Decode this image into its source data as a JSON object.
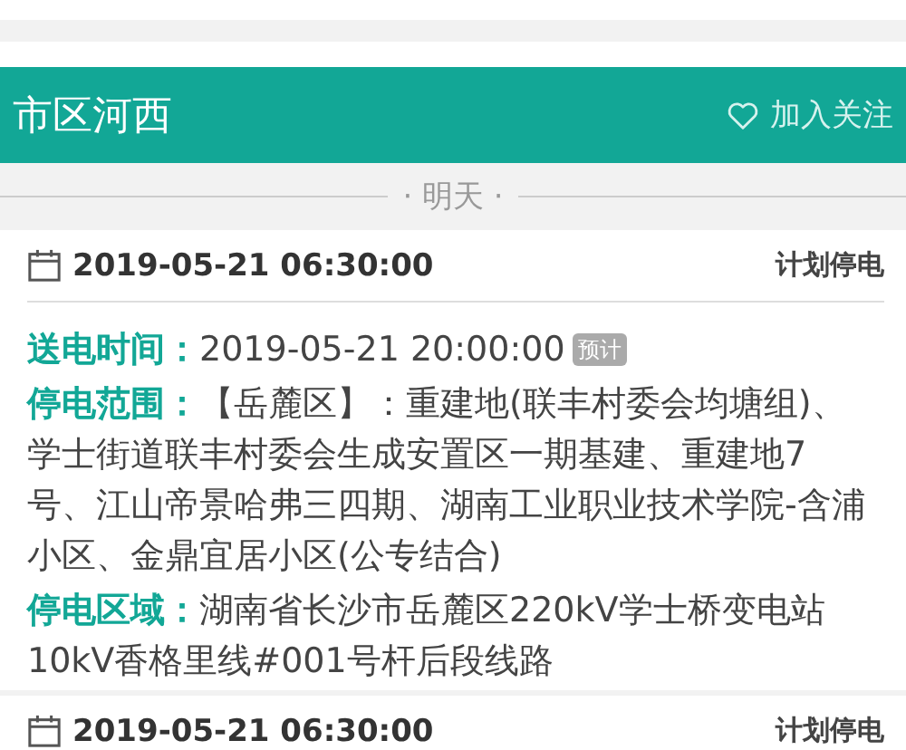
{
  "region": {
    "title": "市区河西",
    "follow_label": "加入关注"
  },
  "day_label": "· 明天 ·",
  "outages": [
    {
      "date": "2019-05-21 06:30:00",
      "type": "计划停电",
      "fields": [
        {
          "label": "送电时间：",
          "value": "2019-05-21 20:00:00",
          "badge": "预计"
        },
        {
          "label": "停电范围：",
          "value": "【岳麓区】：重建地(联丰村委会均塘组)、学士街道联丰村委会生成安置区一期基建、重建地7号、江山帝景哈弗三四期、湖南工业职业技术学院-含浦小区、金鼎宜居小区(公专结合)"
        },
        {
          "label": "停电区域：",
          "value": "湖南省长沙市岳麓区220kV学士桥变电站10kV香格里线#001号杆后段线路"
        }
      ]
    },
    {
      "date": "2019-05-21 06:30:00",
      "type": "计划停电"
    }
  ]
}
